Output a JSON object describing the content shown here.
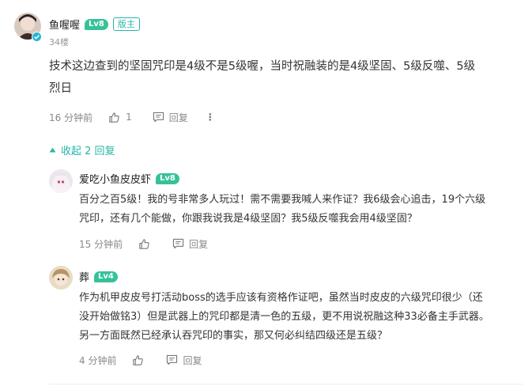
{
  "main_comment": {
    "username": "鱼喔喔",
    "level": "Lv8",
    "badge": "版主",
    "floor": "34楼",
    "text_line1": "技术这边查到的坚固咒印是4级不是5级喔，当时祝融装的是4级坚固、5级反噬、5级",
    "text_line2": "烈日",
    "time": "16 分钟前",
    "like_count": "1",
    "reply_label": "回复",
    "more_label": "⋮"
  },
  "collapse_label": "收起 2 回复",
  "replies": [
    {
      "username": "爱吃小鱼皮皮虾",
      "level": "Lv8",
      "text_line1": "百分之百5级！我的号非常多人玩过！需不需要我喊人来作证？我6级会心追击，19个六级",
      "text_line2": "咒印，还有几个能做，你跟我说我是4级坚固？我5级反噬我会用4级坚固？",
      "time": "15 分钟前",
      "reply_label": "回复"
    },
    {
      "username": "葬",
      "level": "Lv4",
      "text_line1": "作为机甲皮皮号打活动boss的选手应该有资格作证吧，虽然当时皮皮的六级咒印很少（还",
      "text_line2": "没开始做铭3）但是武器上的咒印都是清一色的五级，更不用说祝融这种33必备主手武器。",
      "text_line3": "另一方面既然已经承认吞咒印的事实，那又何必纠结四级还是五级？",
      "time": "4 分钟前",
      "reply_label": "回复"
    }
  ],
  "colors": {
    "accent": "#26b7a8",
    "level_badge": "#35c29a",
    "text": "#333333",
    "meta": "#888888"
  }
}
